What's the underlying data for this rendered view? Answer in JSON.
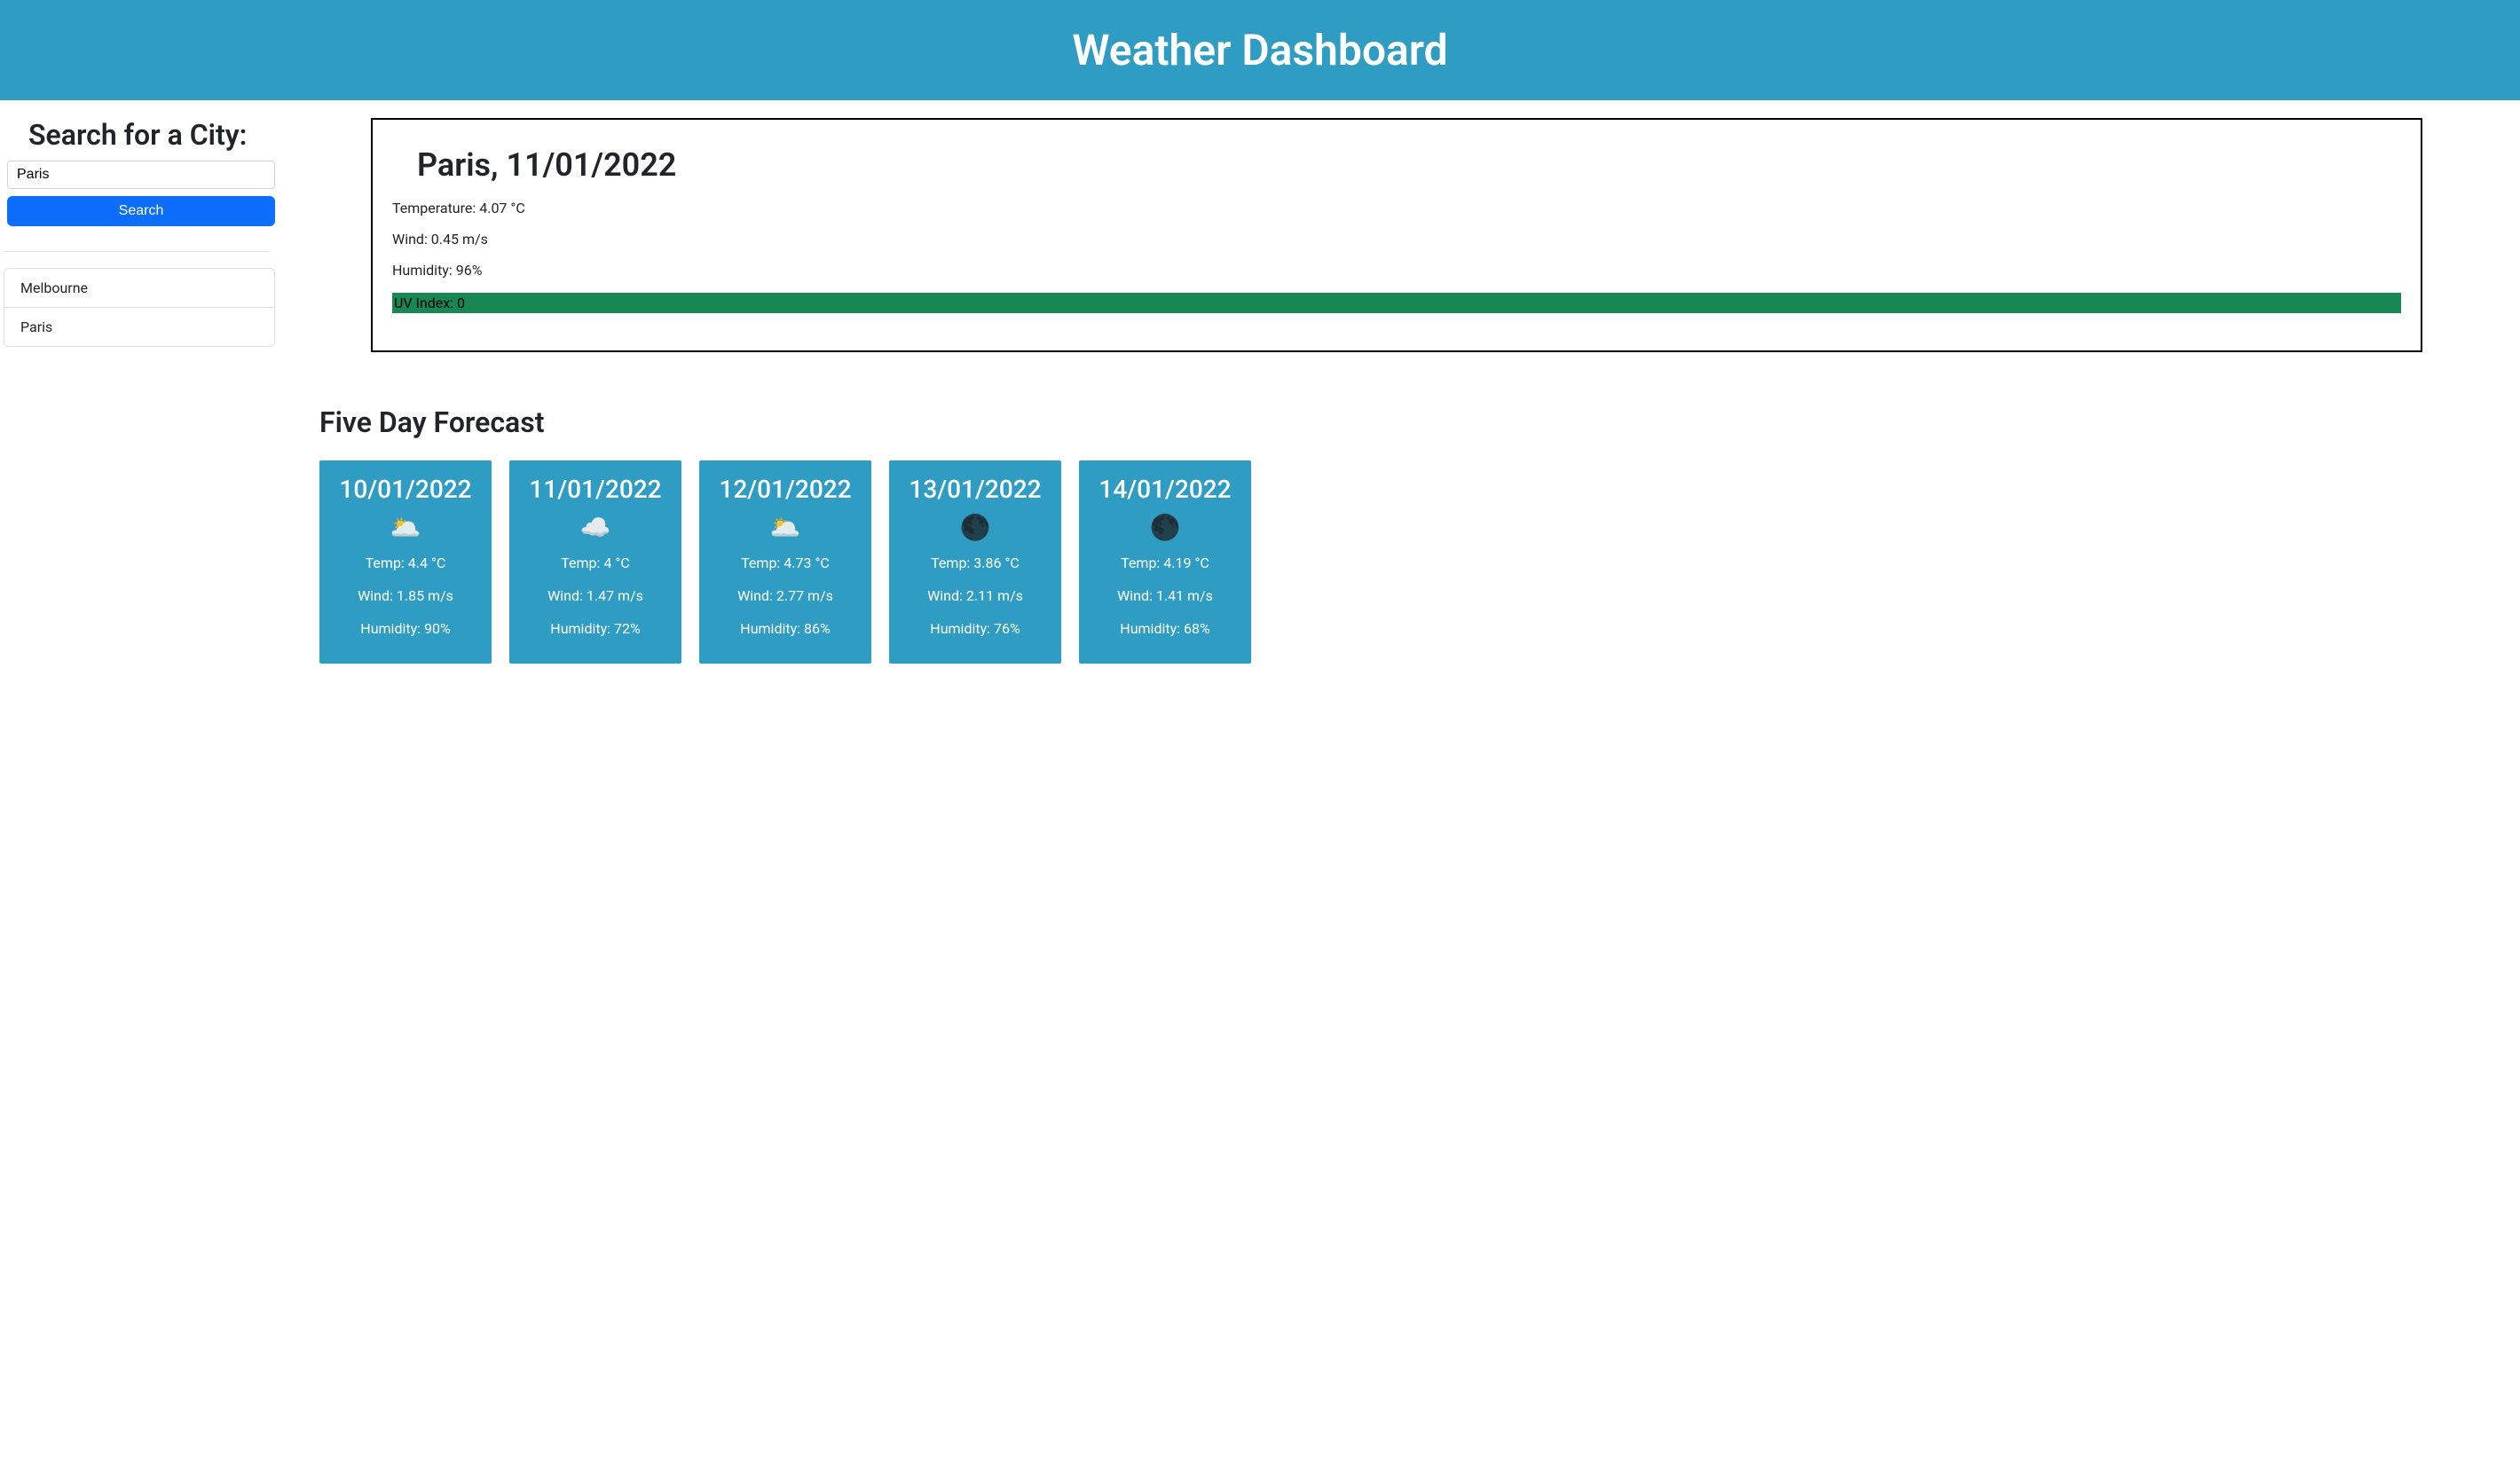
{
  "header": {
    "title": "Weather Dashboard"
  },
  "search": {
    "heading": "Search for a City:",
    "value": "Paris",
    "button_label": "Search",
    "history": [
      "Melbourne",
      "Paris"
    ]
  },
  "current": {
    "heading": "Paris, 11/01/2022",
    "temperature": "Temperature: 4.07 °C",
    "wind": "Wind: 0.45 m/s",
    "humidity": "Humidity: 96%",
    "uv": "UV Index: 0",
    "uv_color": "#198754"
  },
  "forecast": {
    "heading": "Five Day Forecast",
    "days": [
      {
        "date": "10/01/2022",
        "icon": "🌥️",
        "temp": "Temp: 4.4 °C",
        "wind": "Wind: 1.85 m/s",
        "humidity": "Humidity: 90%"
      },
      {
        "date": "11/01/2022",
        "icon": "☁️",
        "temp": "Temp: 4 °C",
        "wind": "Wind: 1.47 m/s",
        "humidity": "Humidity: 72%"
      },
      {
        "date": "12/01/2022",
        "icon": "🌥️",
        "temp": "Temp: 4.73 °C",
        "wind": "Wind: 2.77 m/s",
        "humidity": "Humidity: 86%"
      },
      {
        "date": "13/01/2022",
        "icon": "🌑",
        "temp": "Temp: 3.86 °C",
        "wind": "Wind: 2.11 m/s",
        "humidity": "Humidity: 76%"
      },
      {
        "date": "14/01/2022",
        "icon": "🌑",
        "temp": "Temp: 4.19 °C",
        "wind": "Wind: 1.41 m/s",
        "humidity": "Humidity: 68%"
      }
    ]
  }
}
